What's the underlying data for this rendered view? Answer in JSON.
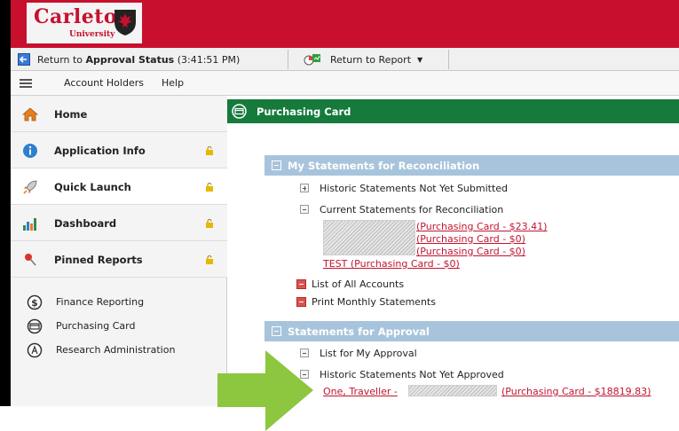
{
  "banner": {
    "logo_name": "Carleton",
    "logo_sub": "University"
  },
  "toolbar": {
    "return_prefix": "Return to ",
    "return_bold": "Approval Status",
    "return_time": " (3:41:51 PM)",
    "report_label": "Return to Report"
  },
  "menubar": {
    "items": [
      "Account Holders",
      "Help"
    ]
  },
  "sidebar": {
    "items": [
      {
        "label": "Home",
        "icon": "home-icon"
      },
      {
        "label": "Application Info",
        "icon": "info-icon"
      },
      {
        "label": "Quick Launch",
        "icon": "rocket-icon"
      },
      {
        "label": "Dashboard",
        "icon": "bar-chart-icon"
      },
      {
        "label": "Pinned Reports",
        "icon": "pin-icon"
      }
    ],
    "links": [
      {
        "label": "Finance Reporting",
        "icon": "dollar-icon"
      },
      {
        "label": "Purchasing Card",
        "icon": "card-icon"
      },
      {
        "label": "Research Administration",
        "icon": "research-icon"
      }
    ]
  },
  "main": {
    "title": "Purchasing Card",
    "section1": {
      "title": "My Statements for Reconciliation",
      "historic": "Historic Statements Not Yet Submitted",
      "current": "Current Statements for Reconciliation",
      "cards": [
        "(Purchasing Card - $23.41)",
        "(Purchasing Card - $0)",
        "(Purchasing Card - $0)"
      ],
      "test_card": "TEST (Purchasing Card - $0)",
      "all_accounts": "List of All Accounts",
      "print_monthly": "Print Monthly Statements"
    },
    "section2": {
      "title": "Statements for Approval",
      "list_for_me": "List for My Approval",
      "historic_not_approved": "Historic Statements Not Yet Approved",
      "traveller_name": "One, Traveller -",
      "traveller_card": "(Purchasing Card - $18819.83)"
    }
  },
  "colors": {
    "banner": "#c8102e",
    "header_green": "#157a3c",
    "section_blue": "#a8c4dc",
    "link_red": "#c0152f",
    "arrow_green": "#8dc63f"
  }
}
